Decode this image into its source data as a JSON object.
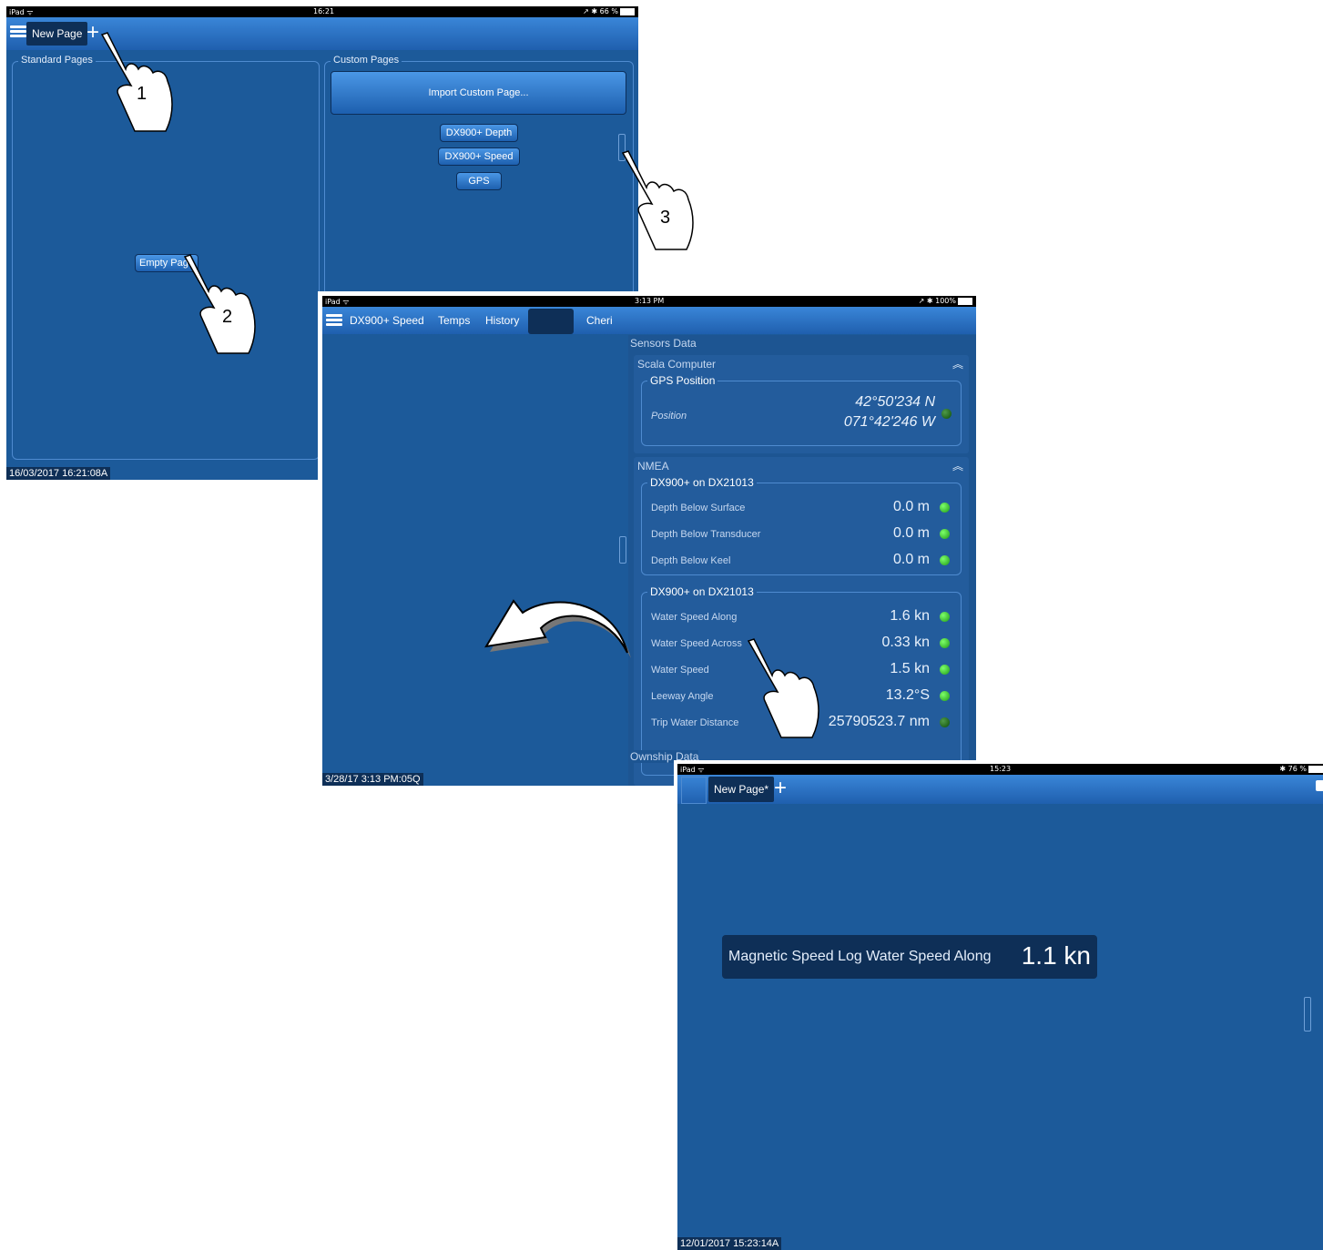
{
  "screen1": {
    "status": {
      "device": "iPad ᯤ",
      "time": "16:21",
      "battery": "↗ ✱ 66 %"
    },
    "tab": "New Page",
    "standard_pages_title": "Standard Pages",
    "custom_pages_title": "Custom Pages",
    "import_button": "Import Custom Page...",
    "custom_pages": [
      "DX900+ Depth",
      "DX900+ Speed",
      "GPS"
    ],
    "empty_page_button": "Empty Page",
    "timestamp": "16/03/2017 16:21:08A"
  },
  "screen2": {
    "status": {
      "device": "iPad ᯤ",
      "time": "3:13 PM",
      "battery": "↗ ✱ 100%"
    },
    "tabs": [
      "DX900+ Speed",
      "Temps",
      "History",
      "",
      "Cheri"
    ],
    "sensors_title": "Sensors Data",
    "scala": {
      "title": "Scala Computer",
      "gps_title": "GPS Position",
      "position_label": "Position",
      "lat": "42°50'234 N",
      "lon": "071°42'246 W"
    },
    "nmea": {
      "title": "NMEA",
      "depth_group": "DX900+ on DX21013",
      "depth_rows": [
        {
          "label": "Depth Below Surface",
          "value": "0.0 m"
        },
        {
          "label": "Depth Below Transducer",
          "value": "0.0 m"
        },
        {
          "label": "Depth Below Keel",
          "value": "0.0 m"
        }
      ],
      "speed_group": "DX900+ on DX21013",
      "speed_rows": [
        {
          "label": "Water Speed Along",
          "value": "1.6 kn"
        },
        {
          "label": "Water Speed Across",
          "value": "0.33 kn"
        },
        {
          "label": "Water Speed",
          "value": "1.5 kn"
        },
        {
          "label": "Leeway Angle",
          "value": "13.2°S"
        },
        {
          "label": "Trip Water Distance",
          "value": "25790523.7 nm"
        }
      ]
    },
    "ownship_title": "Ownship Data",
    "timestamp": "3/28/17 3:13 PM:05Q"
  },
  "screen3": {
    "status": {
      "device": "iPad ᯤ",
      "time": "15:23",
      "battery": "✱ 76 %"
    },
    "tab": "New Page*",
    "widget_label": "Magnetic Speed Log Water Speed Along",
    "widget_value": "1.1 kn",
    "timestamp": "12/01/2017 15:23:14A"
  },
  "steps": [
    "1",
    "2",
    "3"
  ]
}
